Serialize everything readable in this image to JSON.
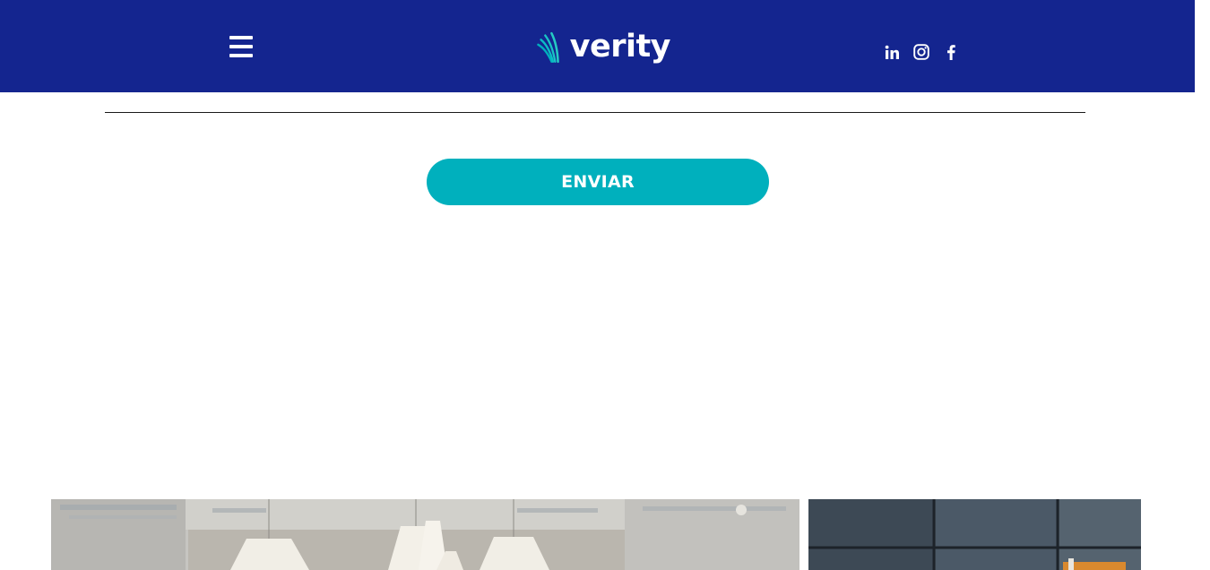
{
  "header": {
    "brand": "verity",
    "menu_icon": "hamburger-menu-icon",
    "socials": [
      {
        "name": "linkedin",
        "icon": "linkedin-icon"
      },
      {
        "name": "instagram",
        "icon": "instagram-icon"
      },
      {
        "name": "facebook",
        "icon": "facebook-icon"
      }
    ]
  },
  "form": {
    "submit_label": "ENVIAR"
  },
  "colors": {
    "header_bg": "#14258f",
    "accent": "#00b0bd",
    "logo_dot": "#e8336f"
  },
  "images": [
    {
      "subject": "office-interior-photo"
    },
    {
      "subject": "building-facade-photo"
    }
  ]
}
